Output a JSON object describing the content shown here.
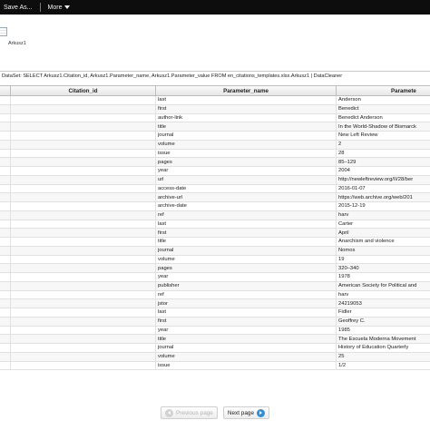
{
  "toolbar": {
    "save_as_label": "Save As...",
    "more_label": "More"
  },
  "sheet": {
    "name": "Arkusz1"
  },
  "dataset_text": "DataSet: SELECT Arkusz1.Citation_id, Arkusz1.Parameter_name, Arkusz1.Parameter_value FROM en_citations_templates.xlsx.Arkusz1 | DataCleaner",
  "table": {
    "columns": [
      "Citation_id",
      "Parameter_name",
      "Paramete"
    ],
    "rows": [
      {
        "name": "last",
        "value": "Anderson"
      },
      {
        "name": "first",
        "value": "Benedict"
      },
      {
        "name": "author-link",
        "value": "Benedict Anderson"
      },
      {
        "name": "title",
        "value": "In the World-Shadow of Bismarck"
      },
      {
        "name": "journal",
        "value": "New Left Review"
      },
      {
        "name": "volume",
        "value": "2"
      },
      {
        "name": "issue",
        "value": "28"
      },
      {
        "name": "pages",
        "value": "85–129"
      },
      {
        "name": "year",
        "value": "2004"
      },
      {
        "name": "url",
        "value": "http://newleftreview.org/II/28/ber"
      },
      {
        "name": "access-date",
        "value": "2016-01-07"
      },
      {
        "name": "archive-url",
        "value": "https://web.archive.org/web/201"
      },
      {
        "name": "archive-date",
        "value": "2015-12-19"
      },
      {
        "name": "ref",
        "value": "harv"
      },
      {
        "name": "last",
        "value": "Carter"
      },
      {
        "name": "first",
        "value": "April"
      },
      {
        "name": "title",
        "value": "Anarchism and violence"
      },
      {
        "name": "journal",
        "value": "Nomos"
      },
      {
        "name": "volume",
        "value": "19"
      },
      {
        "name": "pages",
        "value": "320–340"
      },
      {
        "name": "year",
        "value": "1978"
      },
      {
        "name": "publisher",
        "value": "American Society for Political and"
      },
      {
        "name": "ref",
        "value": "harv"
      },
      {
        "name": "jstor",
        "value": "24219053"
      },
      {
        "name": "last",
        "value": "Fidler"
      },
      {
        "name": "first",
        "value": "Geoffrey C."
      },
      {
        "name": "year",
        "value": "1985"
      },
      {
        "name": "title",
        "value": "The Escuela Moderna Movement"
      },
      {
        "name": "journal",
        "value": "History of Education Quarterly"
      },
      {
        "name": "volume",
        "value": "25"
      },
      {
        "name": "issue",
        "value": "1/2"
      }
    ]
  },
  "pager": {
    "previous_label": "Previous page",
    "next_label": "Next page"
  },
  "colors": {
    "toolbar_bg": "#0d0d0d",
    "next_arrow": "#2f8fd8"
  }
}
